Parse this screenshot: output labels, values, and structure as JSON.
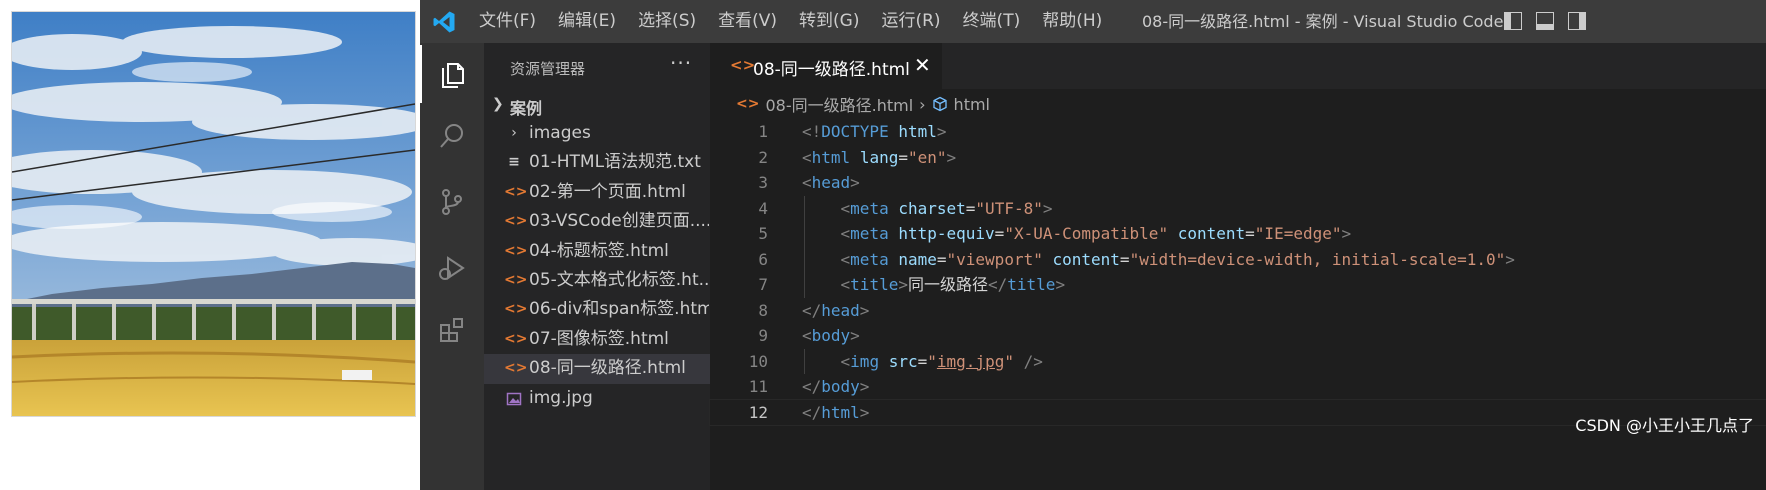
{
  "window": {
    "title": "08-同一级路径.html - 案例 - Visual Studio Code"
  },
  "menu": [
    "文件(F)",
    "编辑(E)",
    "选择(S)",
    "查看(V)",
    "转到(G)",
    "运行(R)",
    "终端(T)",
    "帮助(H)"
  ],
  "activity_bar": {
    "items": [
      {
        "name": "explorer-icon",
        "active": true
      },
      {
        "name": "search-icon",
        "active": false
      },
      {
        "name": "source-control-icon",
        "active": false
      },
      {
        "name": "run-debug-icon",
        "active": false
      },
      {
        "name": "extensions-icon",
        "active": false
      }
    ]
  },
  "sidebar": {
    "title": "资源管理器",
    "more": "···",
    "folder": "案例",
    "files": [
      {
        "label": "images",
        "icon": "folder-chevron-icon",
        "type": "folder"
      },
      {
        "label": "01-HTML语法规范.txt",
        "icon": "text-file-icon",
        "type": "txt"
      },
      {
        "label": "02-第一个页面.html",
        "icon": "html-file-icon",
        "type": "html"
      },
      {
        "label": "03-VSCode创建页面....",
        "icon": "html-file-icon",
        "type": "html"
      },
      {
        "label": "04-标题标签.html",
        "icon": "html-file-icon",
        "type": "html"
      },
      {
        "label": "05-文本格式化标签.ht...",
        "icon": "html-file-icon",
        "type": "html"
      },
      {
        "label": "06-div和span标签.html",
        "icon": "html-file-icon",
        "type": "html"
      },
      {
        "label": "07-图像标签.html",
        "icon": "html-file-icon",
        "type": "html"
      },
      {
        "label": "08-同一级路径.html",
        "icon": "html-file-icon",
        "type": "html",
        "selected": true
      },
      {
        "label": "img.jpg",
        "icon": "image-file-icon",
        "type": "image"
      }
    ]
  },
  "editor": {
    "tab": {
      "label": "08-同一级路径.html",
      "close": "✕"
    },
    "breadcrumb": {
      "file": "08-同一级路径.html",
      "symbol": "html"
    },
    "current_line": 12,
    "lines": [
      {
        "n": "1",
        "indent": 0,
        "tokens": [
          [
            "punc",
            "<!"
          ],
          [
            "tag",
            "DOCTYPE"
          ],
          [
            "text",
            " "
          ],
          [
            "attr",
            "html"
          ],
          [
            "punc",
            ">"
          ]
        ]
      },
      {
        "n": "2",
        "indent": 0,
        "tokens": [
          [
            "punc",
            "<"
          ],
          [
            "tag",
            "html"
          ],
          [
            "text",
            " "
          ],
          [
            "attr",
            "lang"
          ],
          [
            "text",
            "="
          ],
          [
            "str",
            "\"en\""
          ],
          [
            "punc",
            ">"
          ]
        ]
      },
      {
        "n": "3",
        "indent": 0,
        "tokens": [
          [
            "punc",
            "<"
          ],
          [
            "tag",
            "head"
          ],
          [
            "punc",
            ">"
          ]
        ]
      },
      {
        "n": "4",
        "indent": 1,
        "tokens": [
          [
            "punc",
            "<"
          ],
          [
            "tag",
            "meta"
          ],
          [
            "text",
            " "
          ],
          [
            "attr",
            "charset"
          ],
          [
            "text",
            "="
          ],
          [
            "str",
            "\"UTF-8\""
          ],
          [
            "punc",
            ">"
          ]
        ]
      },
      {
        "n": "5",
        "indent": 1,
        "tokens": [
          [
            "punc",
            "<"
          ],
          [
            "tag",
            "meta"
          ],
          [
            "text",
            " "
          ],
          [
            "attr",
            "http-equiv"
          ],
          [
            "text",
            "="
          ],
          [
            "str",
            "\"X-UA-Compatible\""
          ],
          [
            "text",
            " "
          ],
          [
            "attr",
            "content"
          ],
          [
            "text",
            "="
          ],
          [
            "str",
            "\"IE=edge\""
          ],
          [
            "punc",
            ">"
          ]
        ]
      },
      {
        "n": "6",
        "indent": 1,
        "tokens": [
          [
            "punc",
            "<"
          ],
          [
            "tag",
            "meta"
          ],
          [
            "text",
            " "
          ],
          [
            "attr",
            "name"
          ],
          [
            "text",
            "="
          ],
          [
            "str",
            "\"viewport\""
          ],
          [
            "text",
            " "
          ],
          [
            "attr",
            "content"
          ],
          [
            "text",
            "="
          ],
          [
            "str",
            "\"width=device-width, initial-scale=1.0\""
          ],
          [
            "punc",
            ">"
          ]
        ]
      },
      {
        "n": "7",
        "indent": 1,
        "tokens": [
          [
            "punc",
            "<"
          ],
          [
            "tag",
            "title"
          ],
          [
            "punc",
            ">"
          ],
          [
            "text",
            "同一级路径"
          ],
          [
            "punc",
            "</"
          ],
          [
            "tag",
            "title"
          ],
          [
            "punc",
            ">"
          ]
        ]
      },
      {
        "n": "8",
        "indent": 0,
        "tokens": [
          [
            "punc",
            "</"
          ],
          [
            "tag",
            "head"
          ],
          [
            "punc",
            ">"
          ]
        ]
      },
      {
        "n": "9",
        "indent": 0,
        "tokens": [
          [
            "punc",
            "<"
          ],
          [
            "tag",
            "body"
          ],
          [
            "punc",
            ">"
          ]
        ]
      },
      {
        "n": "10",
        "indent": 1,
        "tokens": [
          [
            "punc",
            "<"
          ],
          [
            "tag",
            "img"
          ],
          [
            "text",
            " "
          ],
          [
            "attr",
            "src"
          ],
          [
            "text",
            "="
          ],
          [
            "str",
            "\""
          ],
          [
            "strlink",
            "img.jpg"
          ],
          [
            "str",
            "\""
          ],
          [
            "text",
            " "
          ],
          [
            "punc",
            "/>"
          ]
        ]
      },
      {
        "n": "11",
        "indent": 0,
        "tokens": [
          [
            "punc",
            "</"
          ],
          [
            "tag",
            "body"
          ],
          [
            "punc",
            ">"
          ]
        ]
      },
      {
        "n": "12",
        "indent": 0,
        "tokens": [
          [
            "punc",
            "</"
          ],
          [
            "tag",
            "html"
          ],
          [
            "punc",
            ">"
          ]
        ]
      }
    ]
  },
  "watermark": "CSDN @小王小王几点了",
  "colors": {
    "html_icon": "#e37933",
    "tag": "#569cd6",
    "attr": "#9cdcfe",
    "string": "#ce9178",
    "punctuation": "#808080"
  }
}
